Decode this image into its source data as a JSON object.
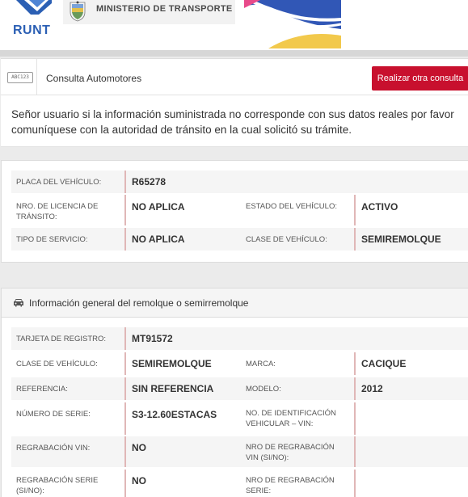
{
  "header": {
    "runt_logo_text": "RUNT",
    "ministry_text": "MINISTERIO DE TRANSPORTE"
  },
  "consulta_bar": {
    "badge": "ABC123",
    "title": "Consulta Automotores",
    "button": "Realizar otra consulta"
  },
  "notice": "Señor usuario si la información suministrada no corresponde con sus datos reales por favor comuníquese con la autoridad de tránsito en la cual solicitó su trámite.",
  "vehicle": {
    "placa_label": "PLACA DEL VEHÍCULO:",
    "placa_value": "R65278",
    "licencia_label": "NRO. DE LICENCIA DE TRÁNSITO:",
    "licencia_value": "NO APLICA",
    "estado_label": "ESTADO DEL VEHÍCULO:",
    "estado_value": "ACTIVO",
    "servicio_label": "TIPO DE SERVICIO:",
    "servicio_value": "NO APLICA",
    "clase_label": "CLASE DE VEHÍCULO:",
    "clase_value": "SEMIREMOLQUE"
  },
  "remolque": {
    "title": "Información general del remolque o semirremolque",
    "tarjeta_label": "TARJETA DE REGISTRO:",
    "tarjeta_value": "MT91572",
    "clase_label": "CLASE DE VEHÍCULO:",
    "clase_value": "SEMIREMOLQUE",
    "marca_label": "MARCA:",
    "marca_value": "CACIQUE",
    "referencia_label": "REFERENCIA:",
    "referencia_value": "SIN REFERENCIA",
    "modelo_label": "MODELO:",
    "modelo_value": "2012",
    "serie_label": "NÚMERO DE SERIE:",
    "serie_value": "S3-12.60ESTACAS",
    "vin_label": "NO. DE IDENTIFICACIÓN VEHICULAR – VIN:",
    "vin_value": "",
    "regrab_vin_label": "REGRABACIÓN VIN:",
    "regrab_vin_value": "NO",
    "nro_regrab_vin_label": "NRO DE REGRABACIÓN VIN (SI/NO):",
    "nro_regrab_vin_value": "",
    "regrab_serie_label": "REGRABACIÓN SERIE (SI/NO):",
    "regrab_serie_value": "NO",
    "nro_regrab_serie_label": "NRO DE REGRABACIÓN SERIE:",
    "nro_regrab_serie_value": ""
  },
  "colors": {
    "accent_red": "#c8102e",
    "runt_blue": "#2b5fb4"
  }
}
